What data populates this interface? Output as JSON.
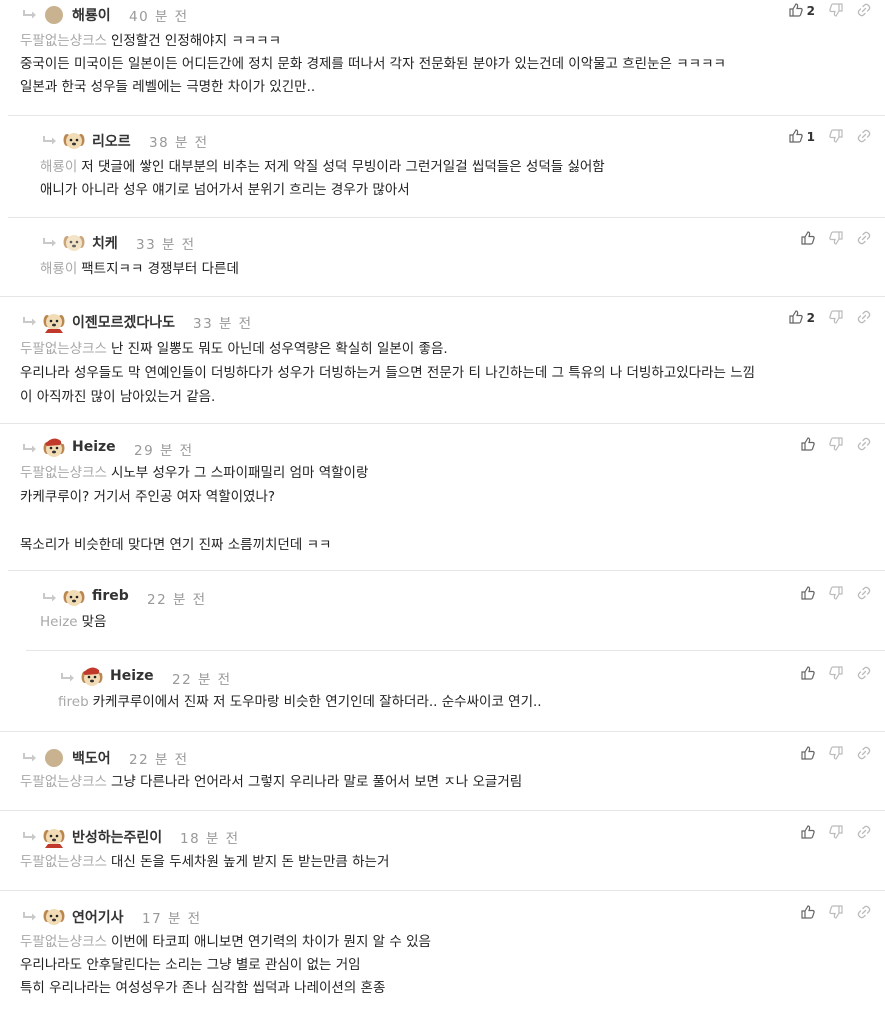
{
  "comments": [
    {
      "nick": "해룡이",
      "time": "40 분 전",
      "likes": "2",
      "avatar": "dot",
      "mention": "두팔없는샹크스",
      "lines": [
        "인정할건 인정해야지 ㅋㅋㅋㅋ",
        "중국이든 미국이든 일본이든 어디든간에 정치 문화 경제를 떠나서 각자 전문화된 분야가 있는건데 이악물고 흐린눈은 ㅋㅋㅋㅋ",
        "일본과 한국 성우들 레벨에는 극명한 차이가 있긴만.."
      ]
    },
    {
      "nick": "리오르",
      "time": "38 분 전",
      "likes": "1",
      "avatar": "puppy",
      "mention": "해룡이",
      "lines": [
        "저 댓글에 쌓인 대부분의 비추는 저게 악질 성덕 무빙이라 그런거일걸 씹덕들은 성덕들 싫어함",
        "애니가 아니라 성우 얘기로 넘어가서 분위기 흐리는 경우가 많아서"
      ]
    },
    {
      "nick": "치케",
      "time": "33 분 전",
      "likes": "",
      "avatar": "puppy-blur",
      "mention": "해룡이",
      "lines": [
        "팩트지ㅋㅋ 경쟁부터 다른데"
      ]
    },
    {
      "nick": "이젠모르겠다나도",
      "time": "33 분 전",
      "likes": "2",
      "avatar": "puppy-red",
      "mention": "두팔없는샹크스",
      "lines": [
        "난 진짜 일뽕도 뭐도 아닌데 성우역량은 확실히 일본이 좋음.",
        "우리나라 성우들도 막 연예인들이 더빙하다가 성우가 더빙하는거 들으면 전문가 티 나긴하는데 그 특유의 나 더빙하고있다라는 느낌",
        "이 아직까진 많이 남아있는거 같음."
      ]
    },
    {
      "nick": "Heize",
      "time": "29 분 전",
      "likes": "",
      "avatar": "puppy-santa",
      "mention": "두팔없는샹크스",
      "lines": [
        "시노부 성우가 그 스파이패밀리 엄마 역할이랑",
        "카케쿠루이? 거기서 주인공 여자 역할이였나?",
        "",
        "목소리가 비슷한데 맞다면 연기 진짜 소름끼치던데 ㅋㅋ"
      ]
    },
    {
      "nick": "fireb",
      "time": "22 분 전",
      "likes": "",
      "avatar": "puppy",
      "mention": "Heize",
      "lines": [
        "맞음"
      ]
    },
    {
      "nick": "Heize",
      "time": "22 분 전",
      "likes": "",
      "avatar": "puppy-santa",
      "mention": "fireb",
      "lines": [
        "카케쿠루이에서 진짜 저 도우마랑 비슷한 연기인데 잘하더라.. 순수싸이코 연기.."
      ]
    },
    {
      "nick": "백도어",
      "time": "22 분 전",
      "likes": "",
      "avatar": "dot",
      "mention": "두팔없는샹크스",
      "lines": [
        "그냥 다른나라 언어라서 그렇지 우리나라 말로 풀어서 보면 ㅈ나 오글거림"
      ]
    },
    {
      "nick": "반성하는주린이",
      "time": "18 분 전",
      "likes": "",
      "avatar": "puppy-red",
      "mention": "두팔없는샹크스",
      "lines": [
        "대신 돈을 두세차원 높게 받지 돈 받는만큼 하는거"
      ]
    },
    {
      "nick": "연어기사",
      "time": "17 분 전",
      "likes": "",
      "avatar": "puppy",
      "mention": "두팔없는샹크스",
      "lines": [
        "이번에 타코피 애니보면 연기력의 차이가 뭔지 알 수 있음",
        "우리나라도 안후달린다는 소리는 그냥 별로 관심이 없는 거임",
        "특히 우리나라는 여성성우가 존나 심각함 씹덕과 나레이션의 혼종"
      ]
    }
  ],
  "icons": {
    "reply": "reply-arrow-icon",
    "like": "thumbs-up-icon",
    "dislike": "thumbs-down-icon",
    "share": "link-icon"
  },
  "colors": {
    "mention": "#a8a8a8",
    "time": "#999999",
    "divider": "#e6e6e6"
  }
}
